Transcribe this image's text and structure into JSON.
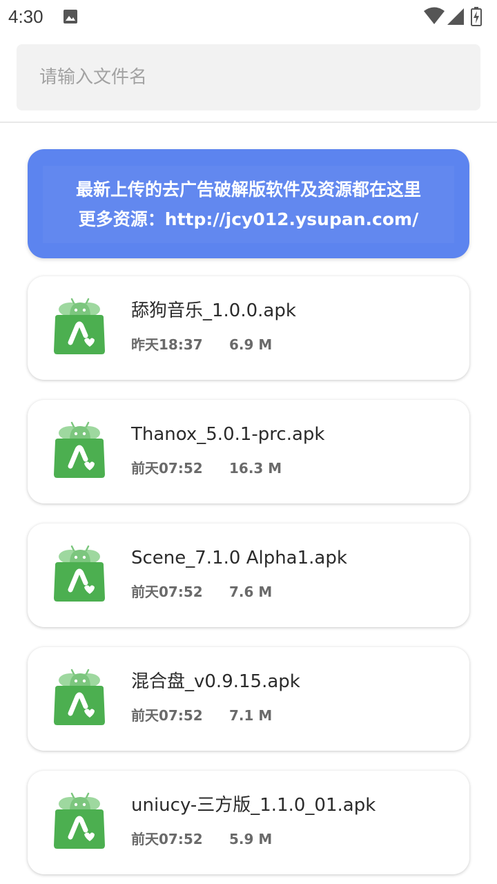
{
  "status_bar": {
    "time": "4:30",
    "icons": [
      "image-icon",
      "wifi-icon",
      "signal-icon",
      "battery-charging-icon"
    ]
  },
  "search": {
    "placeholder": "请输入文件名",
    "value": ""
  },
  "banner": {
    "line1": "最新上传的去广告破解版软件及资源都在这里",
    "line2": "更多资源：http://jcy012.ysupan.com/",
    "color": "#5c84ef"
  },
  "files": [
    {
      "name": "舔狗音乐_1.0.0.apk",
      "date": "昨天18:37",
      "size": "6.9 M",
      "icon": "apk-android-icon"
    },
    {
      "name": "Thanox_5.0.1-prc.apk",
      "date": "前天07:52",
      "size": "16.3 M",
      "icon": "apk-android-icon"
    },
    {
      "name": "Scene_7.1.0 Alpha1.apk",
      "date": "前天07:52",
      "size": "7.6 M",
      "icon": "apk-android-icon"
    },
    {
      "name": "混合盘_v0.9.15.apk",
      "date": "前天07:52",
      "size": "7.1 M",
      "icon": "apk-android-icon"
    },
    {
      "name": "uniucy-三方版_1.1.0_01.apk",
      "date": "前天07:52",
      "size": "5.9 M",
      "icon": "apk-android-icon"
    }
  ],
  "colors": {
    "apk_green": "#4caf50",
    "apk_light_green": "#9ed89f",
    "banner_blue": "#5c84ef"
  }
}
